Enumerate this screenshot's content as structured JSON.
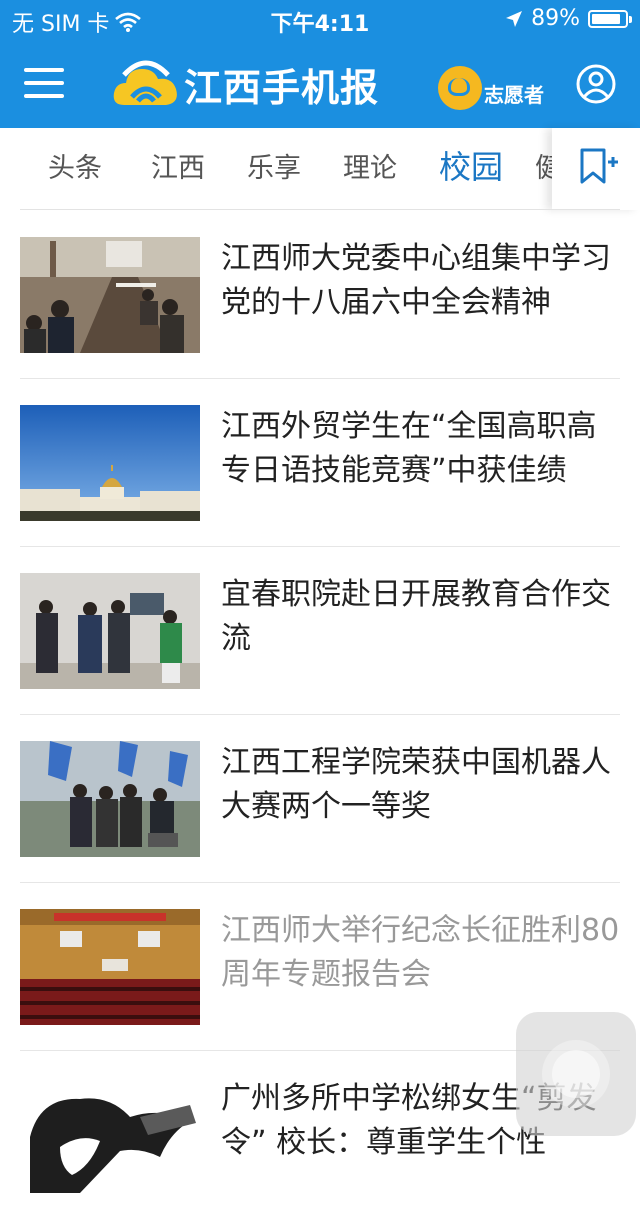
{
  "status_bar": {
    "carrier": "无 SIM 卡",
    "time": "下午4:11",
    "battery": "89%",
    "battery_level": 0.89
  },
  "header": {
    "app_name": "江西手机报",
    "volunteer_label": "志愿者"
  },
  "tabs": [
    {
      "label": "头条"
    },
    {
      "label": "江西"
    },
    {
      "label": "乐享"
    },
    {
      "label": "理论"
    },
    {
      "label": "校园",
      "active": true
    },
    {
      "label": "健"
    }
  ],
  "news": [
    {
      "title": "江西师大党委中心组集中学习党的十八届六中全会精神",
      "read": false
    },
    {
      "title": "江西外贸学生在“全国高职高专日语技能竞赛”中获佳绩",
      "read": false
    },
    {
      "title": "宜春职院赴日开展教育合作交流",
      "read": false
    },
    {
      "title": "江西工程学院荣获中国机器人大赛两个一等奖",
      "read": false
    },
    {
      "title": "江西师大举行纪念长征胜利80周年专题报告会",
      "read": true
    },
    {
      "title": "广州多所中学松绑女生“剪发令” 校长：尊重学生个性",
      "read": false
    }
  ],
  "colors": {
    "brand_blue": "#1b8fe0",
    "active_tab": "#1b77c4",
    "logo_accent": "#f6c623"
  }
}
